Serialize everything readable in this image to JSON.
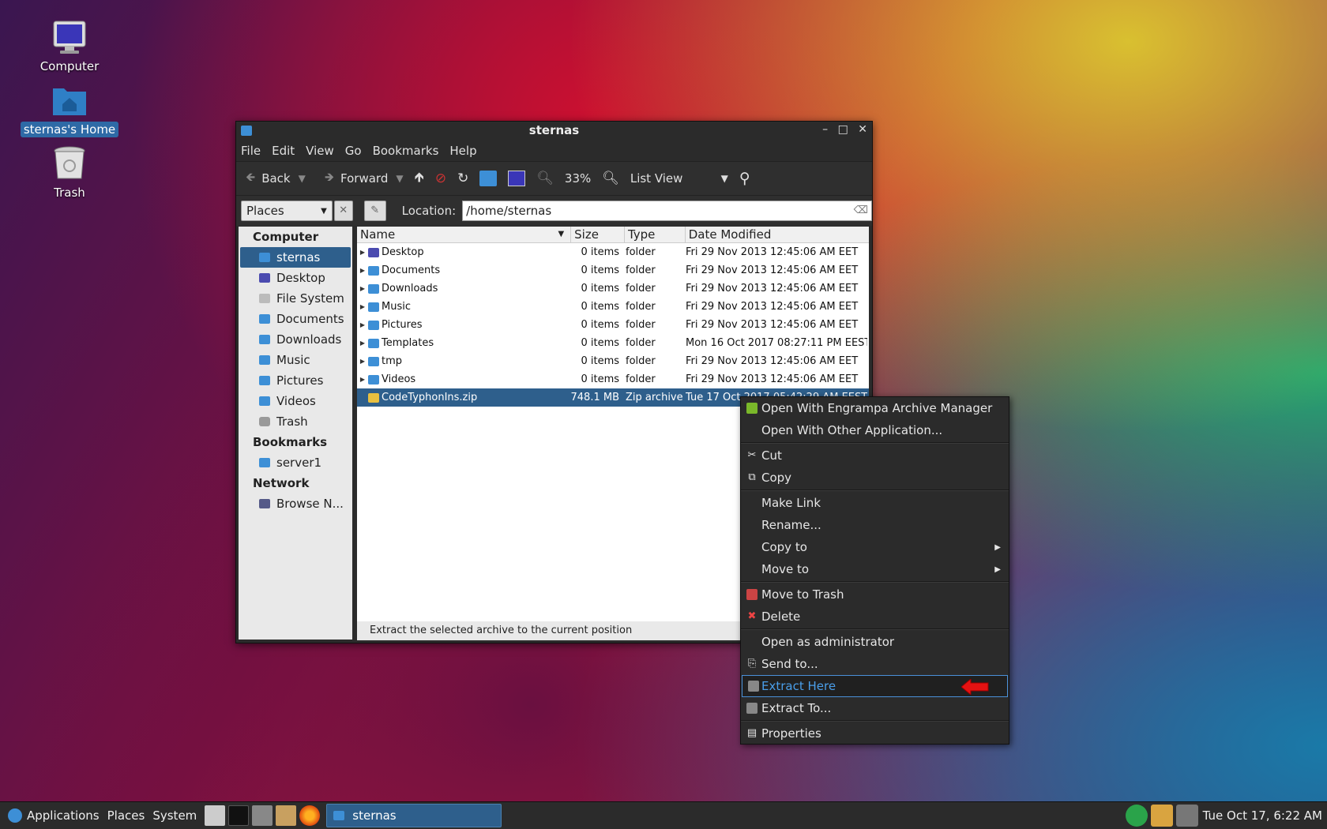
{
  "desktop": {
    "icons": [
      {
        "label": "Computer"
      },
      {
        "label": "sternas's Home"
      },
      {
        "label": "Trash"
      }
    ]
  },
  "window": {
    "title": "sternas",
    "controls": {
      "minimize": "–",
      "maximize": "□",
      "close": "✕"
    },
    "menu": [
      "File",
      "Edit",
      "View",
      "Go",
      "Bookmarks",
      "Help"
    ],
    "toolbar": {
      "back": "Back",
      "forward": "Forward",
      "zoom": "33%",
      "view_mode": "List View"
    },
    "location": {
      "places_label": "Places",
      "label": "Location:",
      "path": "/home/sternas"
    },
    "sidebar": {
      "sections": [
        {
          "heading": "Computer",
          "items": [
            "sternas",
            "Desktop",
            "File System",
            "Documents",
            "Downloads",
            "Music",
            "Pictures",
            "Videos",
            "Trash"
          ]
        },
        {
          "heading": "Bookmarks",
          "items": [
            "server1"
          ]
        },
        {
          "heading": "Network",
          "items": [
            "Browse N..."
          ]
        }
      ]
    },
    "columns": {
      "name": "Name",
      "size": "Size",
      "type": "Type",
      "date": "Date Modified"
    },
    "files": [
      {
        "name": "Desktop",
        "size": "0 items",
        "type": "folder",
        "date": "Fri 29 Nov 2013 12:45:06 AM EET"
      },
      {
        "name": "Documents",
        "size": "0 items",
        "type": "folder",
        "date": "Fri 29 Nov 2013 12:45:06 AM EET"
      },
      {
        "name": "Downloads",
        "size": "0 items",
        "type": "folder",
        "date": "Fri 29 Nov 2013 12:45:06 AM EET"
      },
      {
        "name": "Music",
        "size": "0 items",
        "type": "folder",
        "date": "Fri 29 Nov 2013 12:45:06 AM EET"
      },
      {
        "name": "Pictures",
        "size": "0 items",
        "type": "folder",
        "date": "Fri 29 Nov 2013 12:45:06 AM EET"
      },
      {
        "name": "Templates",
        "size": "0 items",
        "type": "folder",
        "date": "Mon 16 Oct 2017 08:27:11 PM EEST"
      },
      {
        "name": "tmp",
        "size": "0 items",
        "type": "folder",
        "date": "Fri 29 Nov 2013 12:45:06 AM EET"
      },
      {
        "name": "Videos",
        "size": "0 items",
        "type": "folder",
        "date": "Fri 29 Nov 2013 12:45:06 AM EET"
      },
      {
        "name": "CodeTyphonIns.zip",
        "size": "748.1 MB",
        "type": "Zip archive",
        "date": "Tue 17 Oct 2017 05:42:29 AM EEST"
      }
    ],
    "status": "Extract the selected archive to the current position"
  },
  "context_menu": {
    "items": [
      "Open With Engrampa Archive Manager",
      "Open With Other Application...",
      "Cut",
      "Copy",
      "Make Link",
      "Rename...",
      "Copy to",
      "Move to",
      "Move to Trash",
      "Delete",
      "Open as administrator",
      "Send to...",
      "Extract Here",
      "Extract To...",
      "Properties"
    ],
    "highlighted": "Extract Here",
    "highlight_color": "#4a9ee9"
  },
  "taskbar": {
    "applications": "Applications",
    "places": "Places",
    "system": "System",
    "window_button": "sternas",
    "clock": "Tue Oct 17,  6:22 AM"
  }
}
